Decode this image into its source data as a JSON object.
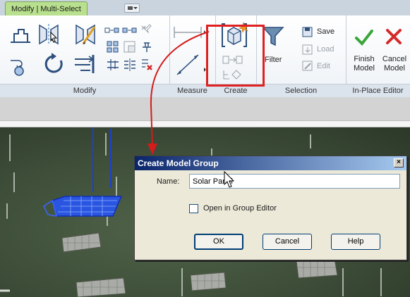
{
  "ribbon": {
    "active_tab": "Modify | Multi-Select",
    "panels": {
      "modify": "Modify",
      "measure": "Measure",
      "create": "Create",
      "selection": "Selection",
      "in_place_editor": "In-Place Editor"
    },
    "buttons": {
      "filter": "Filter",
      "save": "Save",
      "load": "Load",
      "edit": "Edit",
      "finish_model_line1": "Finish",
      "finish_model_line2": "Model",
      "cancel_model_line1": "Cancel",
      "cancel_model_line2": "Model"
    },
    "colors": {
      "active_tab": "#b8e08e",
      "highlight": "#e02020",
      "finish_check": "#3aa53a",
      "cancel_x": "#d42a2a"
    }
  },
  "dialog": {
    "title": "Create Model Group",
    "close_glyph": "×",
    "name_label": "Name:",
    "name_value": "Solar Panel",
    "checkbox_label": "Open in Group Editor",
    "checkbox_checked": false,
    "ok": "OK",
    "cancel": "Cancel",
    "help": "Help"
  }
}
